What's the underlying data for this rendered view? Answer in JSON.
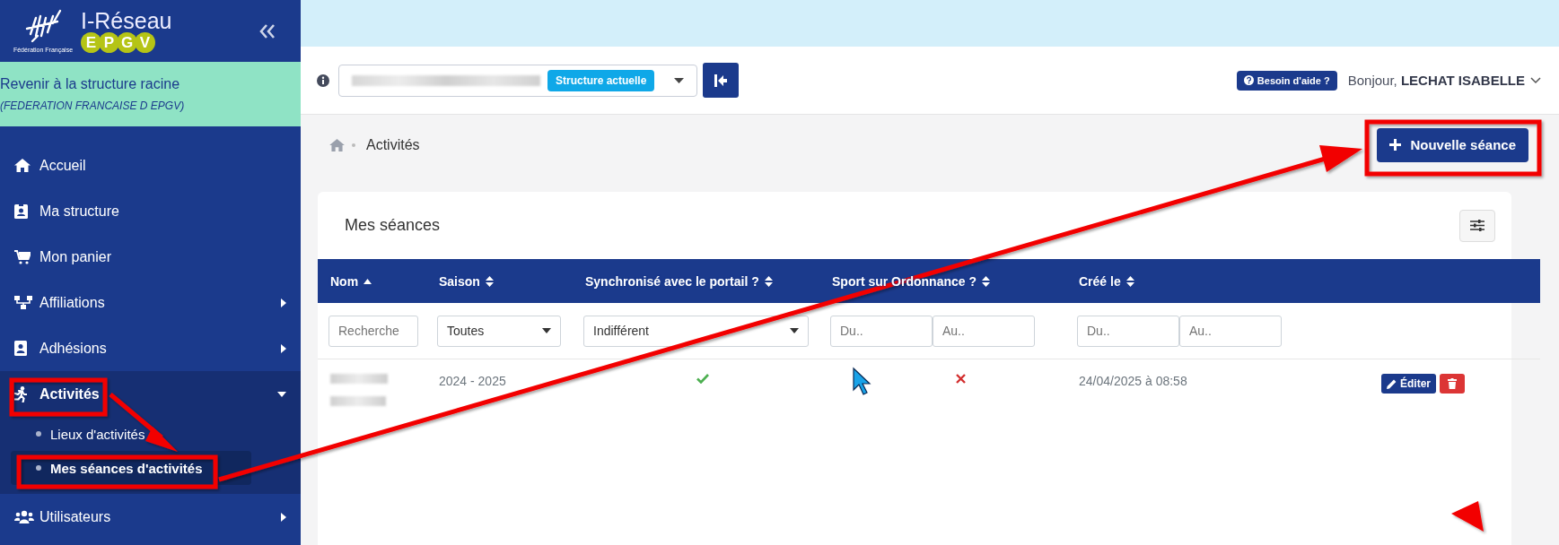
{
  "sidebar": {
    "logo": {
      "title": "I-Réseau",
      "badge": [
        "E",
        "P",
        "G",
        "V"
      ],
      "subtitle": "Fédération Française"
    },
    "root_link": {
      "label": "Revenir à la structure racine",
      "structure": "(FEDERATION FRANCAISE D EPGV)"
    },
    "items": [
      {
        "label": "Accueil",
        "kind": "link",
        "selected": false
      },
      {
        "label": "Ma structure",
        "kind": "link",
        "selected": false
      },
      {
        "label": "Mon panier",
        "kind": "link",
        "selected": false
      },
      {
        "label": "Affiliations",
        "kind": "group",
        "expanded": false,
        "selected": false
      },
      {
        "label": "Adhésions",
        "kind": "group",
        "expanded": false,
        "selected": false
      },
      {
        "label": "Activités",
        "kind": "group",
        "expanded": true,
        "selected": true,
        "children": [
          {
            "label": "Lieux d'activités",
            "selected": false
          },
          {
            "label": "Mes séances d'activités",
            "selected": true
          }
        ]
      },
      {
        "label": "Utilisateurs",
        "kind": "group",
        "expanded": false,
        "selected": false
      }
    ]
  },
  "topbar": {
    "structure_badge": "Structure actuelle",
    "help_button": "Besoin d'aide ?",
    "greeting": "Bonjour, **LECHAT ISABELLE**"
  },
  "breadcrumb": {
    "current": "Activités"
  },
  "new_button": "Nouvelle séance",
  "card": {
    "title": "Mes séances",
    "columns": [
      {
        "label": "Nom",
        "sorted": true
      },
      {
        "label": "Saison",
        "sorted": false
      },
      {
        "label": "Synchronisé avec le portail ?",
        "sorted": false
      },
      {
        "label": "Sport sur Ordonnance ?",
        "sorted": false
      },
      {
        "label": "Créé le",
        "sorted": false
      }
    ],
    "filters": [
      {
        "kind": "text",
        "placeholder": "Recherche"
      },
      {
        "kind": "select",
        "value": "Toutes"
      },
      {
        "kind": "select",
        "value": "Indifférent"
      },
      {
        "kind": "range",
        "placeholder": "Du..",
        "placeholder_to": "Au.."
      },
      {
        "kind": "range",
        "placeholder": "Du..",
        "placeholder_to": "Au.."
      }
    ],
    "rows": [
      {
        "season": "2024 - 2025",
        "synchronized": true,
        "prescription": false,
        "created": "24/04/2025 à 08:58",
        "edit": "Éditer"
      }
    ]
  }
}
